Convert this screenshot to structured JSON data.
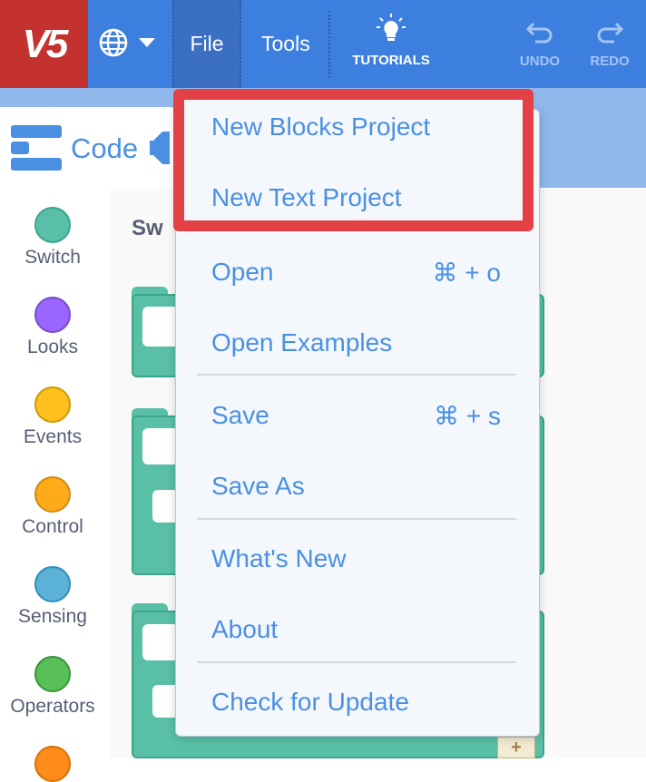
{
  "app": {
    "logo": "V5"
  },
  "menubar": {
    "globe_icon": "globe-icon",
    "file": "File",
    "tools": "Tools",
    "tutorials": "TUTORIALS",
    "undo": "UNDO",
    "redo": "REDO"
  },
  "code_tab": {
    "label": "Code"
  },
  "workspace": {
    "section_label": "Sw"
  },
  "categories": [
    {
      "label": "Switch",
      "color": "#59c0a7"
    },
    {
      "label": "Looks",
      "color": "#9a66ff"
    },
    {
      "label": "Events",
      "color": "#ffbf1f"
    },
    {
      "label": "Control",
      "color": "#ffab19"
    },
    {
      "label": "Sensing",
      "color": "#5cb1d6"
    },
    {
      "label": "Operators",
      "color": "#59c059"
    }
  ],
  "file_menu": {
    "new_blocks": "New Blocks Project",
    "new_text": "New Text Project",
    "open": "Open",
    "open_shortcut": "⌘ + o",
    "open_examples": "Open Examples",
    "save": "Save",
    "save_shortcut": "⌘ + s",
    "save_as": "Save As",
    "whats_new": "What's New",
    "about": "About",
    "check_update": "Check for Update"
  },
  "colors": {
    "menubar": "#3c7fdf",
    "logo_bg": "#c4322f",
    "highlight": "#e34146",
    "menu_text": "#4a90e2"
  }
}
